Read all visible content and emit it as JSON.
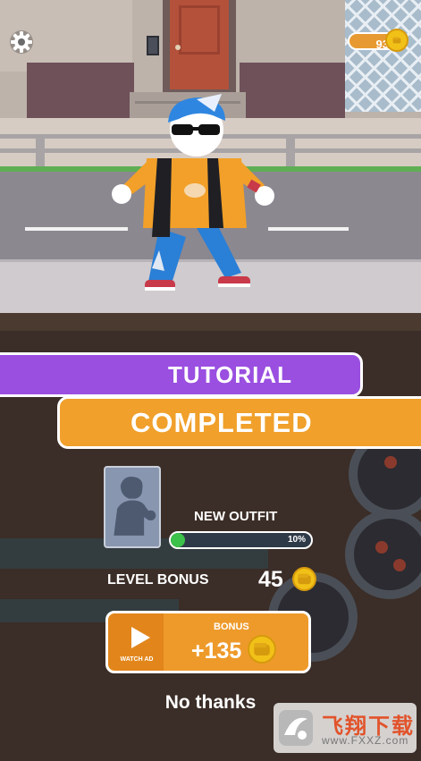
{
  "hud": {
    "settings_icon": "gear-icon",
    "coins": "93",
    "coin_icon": "fist-coin-icon"
  },
  "result": {
    "tutorial_label": "TUTORIAL",
    "completed_label": "COMPLETED"
  },
  "reward": {
    "outfit_label": "NEW OUTFIT",
    "outfit_progress_text": "10%",
    "outfit_progress": 0.1,
    "level_bonus_label": "LEVEL BONUS",
    "level_bonus_value": "45"
  },
  "bonus_button": {
    "watch_ad_label": "WATCH AD",
    "bonus_label": "BONUS",
    "bonus_amount": "+135",
    "icon": "play-icon"
  },
  "decline": {
    "label": "No thanks"
  },
  "watermark": {
    "title": "飞翔下载",
    "url": "www.FXXZ.com"
  },
  "colors": {
    "tutorial_banner": "#9a4fe0",
    "completed_banner": "#f0a02b",
    "progress_fill": "#3cc24a",
    "coin": "#f2c118"
  }
}
